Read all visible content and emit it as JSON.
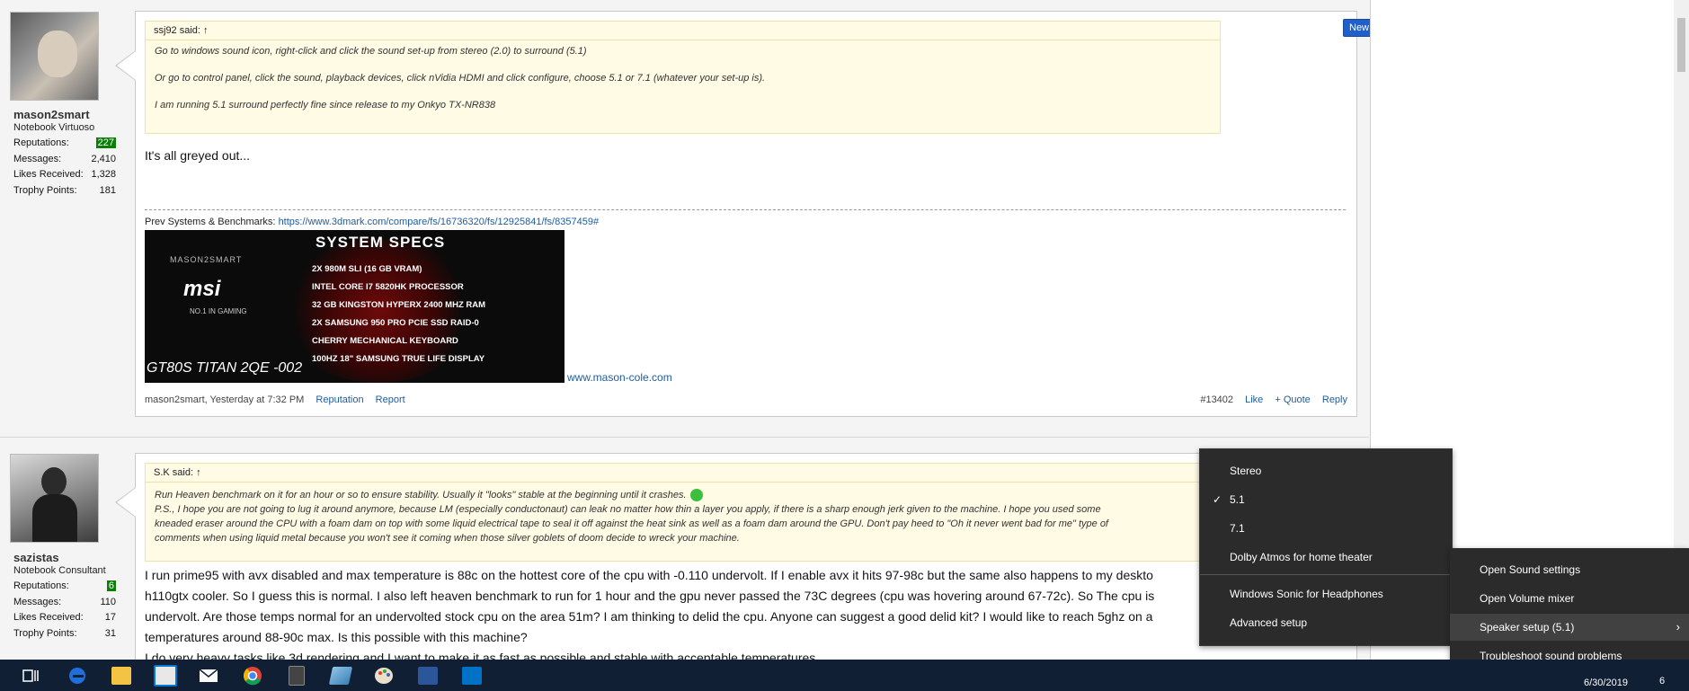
{
  "post1": {
    "username": "mason2smart",
    "user_title": "Notebook Virtuoso",
    "stats": [
      {
        "label": "Reputations:",
        "value": "227"
      },
      {
        "label": "Messages:",
        "value": "2,410"
      },
      {
        "label": "Likes Received:",
        "value": "1,328"
      },
      {
        "label": "Trophy Points:",
        "value": "181"
      }
    ],
    "quote_author": "ssj92 said: ↑",
    "quote_lines": [
      "Go to windows sound icon, right-click and click the sound set-up from stereo (2.0) to surround (5.1)",
      "Or go to control panel, click the sound, playback devices, click nVidia HDMI and click configure, choose 5.1 or 7.1 (whatever your set-up is).",
      "I am running 5.1 surround perfectly fine since release to my Onkyo TX-NR838"
    ],
    "message": "It's all greyed out...",
    "sig_label": "Prev Systems & Benchmarks:",
    "sig_link": "https://www.3dmark.com/compare/fs/16736320/fs/12925841/fs/8357459#",
    "sig_image": {
      "heading": "SYSTEM SPECS",
      "brand": "msi",
      "watermark": "MASON2SMART",
      "tagline": "NO.1 IN GAMING",
      "model": "GT80S TITAN 2QE -002",
      "specs": [
        "2X 980M SLI (16 GB VRAM)",
        "INTEL CORE I7 5820HK PROCESSOR",
        "32 GB KINGSTON HYPERX 2400 MHZ RAM",
        "2X SAMSUNG 950 PRO PCIE SSD RAID-0",
        "CHERRY MECHANICAL KEYBOARD",
        "100HZ 18\" SAMSUNG TRUE LIFE DISPLAY"
      ]
    },
    "site_link": "www.mason-cole.com",
    "footer_meta": "mason2smart, Yesterday at 7:32 PM",
    "footer_reputation": "Reputation",
    "footer_report": "Report",
    "post_number": "#13402",
    "like": "Like",
    "quote_action": "+ Quote",
    "reply": "Reply",
    "new_badge": "New"
  },
  "post2": {
    "username": "sazistas",
    "user_title": "Notebook Consultant",
    "stats": [
      {
        "label": "Reputations:",
        "value": "6"
      },
      {
        "label": "Messages:",
        "value": "110"
      },
      {
        "label": "Likes Received:",
        "value": "17"
      },
      {
        "label": "Trophy Points:",
        "value": "31"
      }
    ],
    "quote_author": "S.K said: ↑",
    "quote_line1": "Run Heaven benchmark on it for an hour or so to ensure stability. Usually it \"looks\" stable at the beginning until it crashes.",
    "quote_line2": "P.S., I hope you are not going to lug it around anymore, because LM (especially conductonaut) can leak no matter how thin a layer you apply, if there is a sharp enough jerk given to the machine. I hope you used some",
    "quote_line3": "kneaded eraser around the CPU with a foam dam on top with some liquid electrical tape to seal it off against the heat sink as well as a foam dam around the GPU. Don't pay heed to \"Oh it never went bad for me\" type of",
    "quote_line4": "comments when using liquid metal because you won't see it coming when those silver goblets of doom decide to wreck your machine.",
    "text_lines": [
      "I run prime95 with avx disabled and max temperature is 88c on the hottest core of the cpu with -0.110 undervolt. If I enable avx it hits 97-98c but the same also happens to my deskto",
      "h110gtx cooler. So I guess this is normal. I also left heaven benchmark to run for 1 hour and the gpu never passed the 73C degrees (cpu was hovering around 67-72c). So The cpu is",
      "undervolt. Are those temps normal for an undervolted stock cpu on the area 51m? I am thinking to delid the cpu. Anyone can suggest a good delid kit? I would like to reach 5ghz on a",
      "temperatures around 88-90c max. Is this possible with this machine?",
      "I do very heavy tasks like 3d rendering and I want to make it as fast as possible and stable with acceptable temperatures."
    ]
  },
  "speaker_menu": {
    "items": [
      "Stereo",
      "5.1",
      "7.1",
      "Dolby Atmos for home theater",
      "Windows Sonic for Headphones",
      "Advanced setup"
    ],
    "checked": "5.1"
  },
  "sound_menu": {
    "items": [
      "Open Sound settings",
      "Open Volume mixer",
      "Speaker setup (5.1)",
      "Troubleshoot sound problems"
    ],
    "highlighted": "Speaker setup (5.1)"
  },
  "taskbar": {
    "icons": [
      "task-view-icon",
      "edge-icon",
      "file-explorer-icon",
      "store-icon",
      "mail-icon",
      "chrome-icon",
      "calculator-icon",
      "paint3d-icon",
      "paint-icon",
      "word-icon",
      "outlook-icon"
    ],
    "date": "6/30/2019",
    "notification_count": "6"
  },
  "colors": {
    "taskbar": "#101f34",
    "menu_bg": "#2b2b2b",
    "link": "#1f5c99",
    "quote_bg": "#fffbe5",
    "new_badge": "#2060c8"
  }
}
